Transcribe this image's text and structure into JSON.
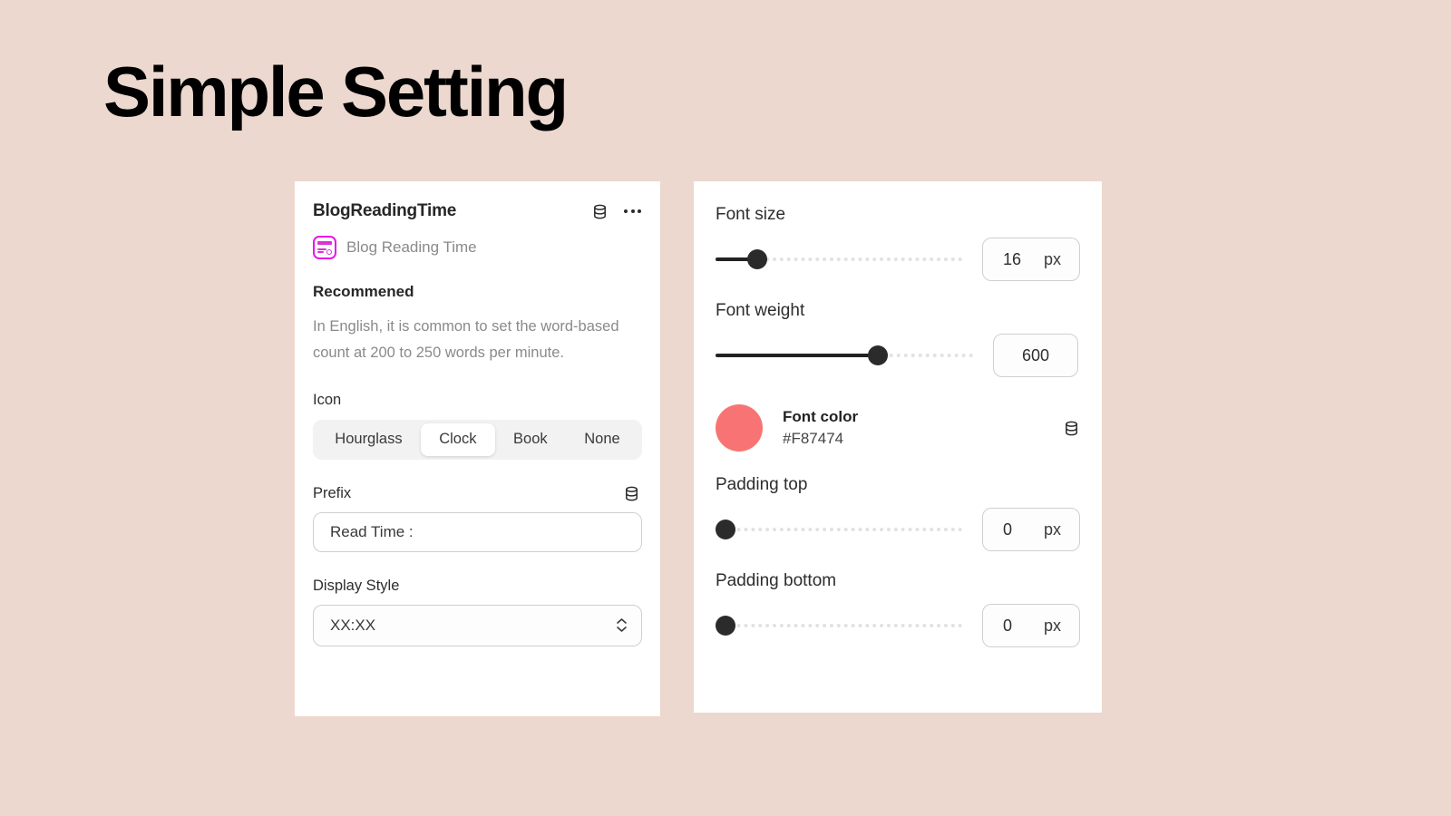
{
  "page": {
    "title": "Simple Setting",
    "background_color": "#ECD8CE"
  },
  "left_card": {
    "header": {
      "title": "BlogReadingTime",
      "db_icon": "database-icon",
      "menu_icon": "more-options-icon"
    },
    "app": {
      "icon": "blog-reading-time-app-icon",
      "name": "Blog Reading Time"
    },
    "recommended": {
      "heading": "Recommened",
      "body": "In English, it is common to set the word-based count at 200 to 250 words per minute."
    },
    "icon_field": {
      "label": "Icon",
      "options": [
        "Hourglass",
        "Clock",
        "Book",
        "None"
      ],
      "selected": "Clock"
    },
    "prefix_field": {
      "label": "Prefix",
      "db_icon": "database-icon",
      "value": "Read Time :",
      "placeholder": "Read Time :"
    },
    "display_style_field": {
      "label": "Display Style",
      "value": "XX:XX",
      "options": [
        "XX:XX"
      ],
      "stepper_icon": "chevron-up-down-icon"
    }
  },
  "right_card": {
    "font_size": {
      "label": "Font size",
      "value": "16",
      "unit": "px",
      "slider_percent": 17
    },
    "font_weight": {
      "label": "Font weight",
      "value": "600",
      "unit": "",
      "slider_percent": 63
    },
    "font_color": {
      "label": "Font color",
      "hex": "#F87474",
      "swatch_color": "#F87474",
      "db_icon": "database-icon"
    },
    "padding_top": {
      "label": "Padding top",
      "value": "0",
      "unit": "px",
      "slider_percent": 0
    },
    "padding_bottom": {
      "label": "Padding bottom",
      "value": "0",
      "unit": "px",
      "slider_percent": 0
    }
  }
}
